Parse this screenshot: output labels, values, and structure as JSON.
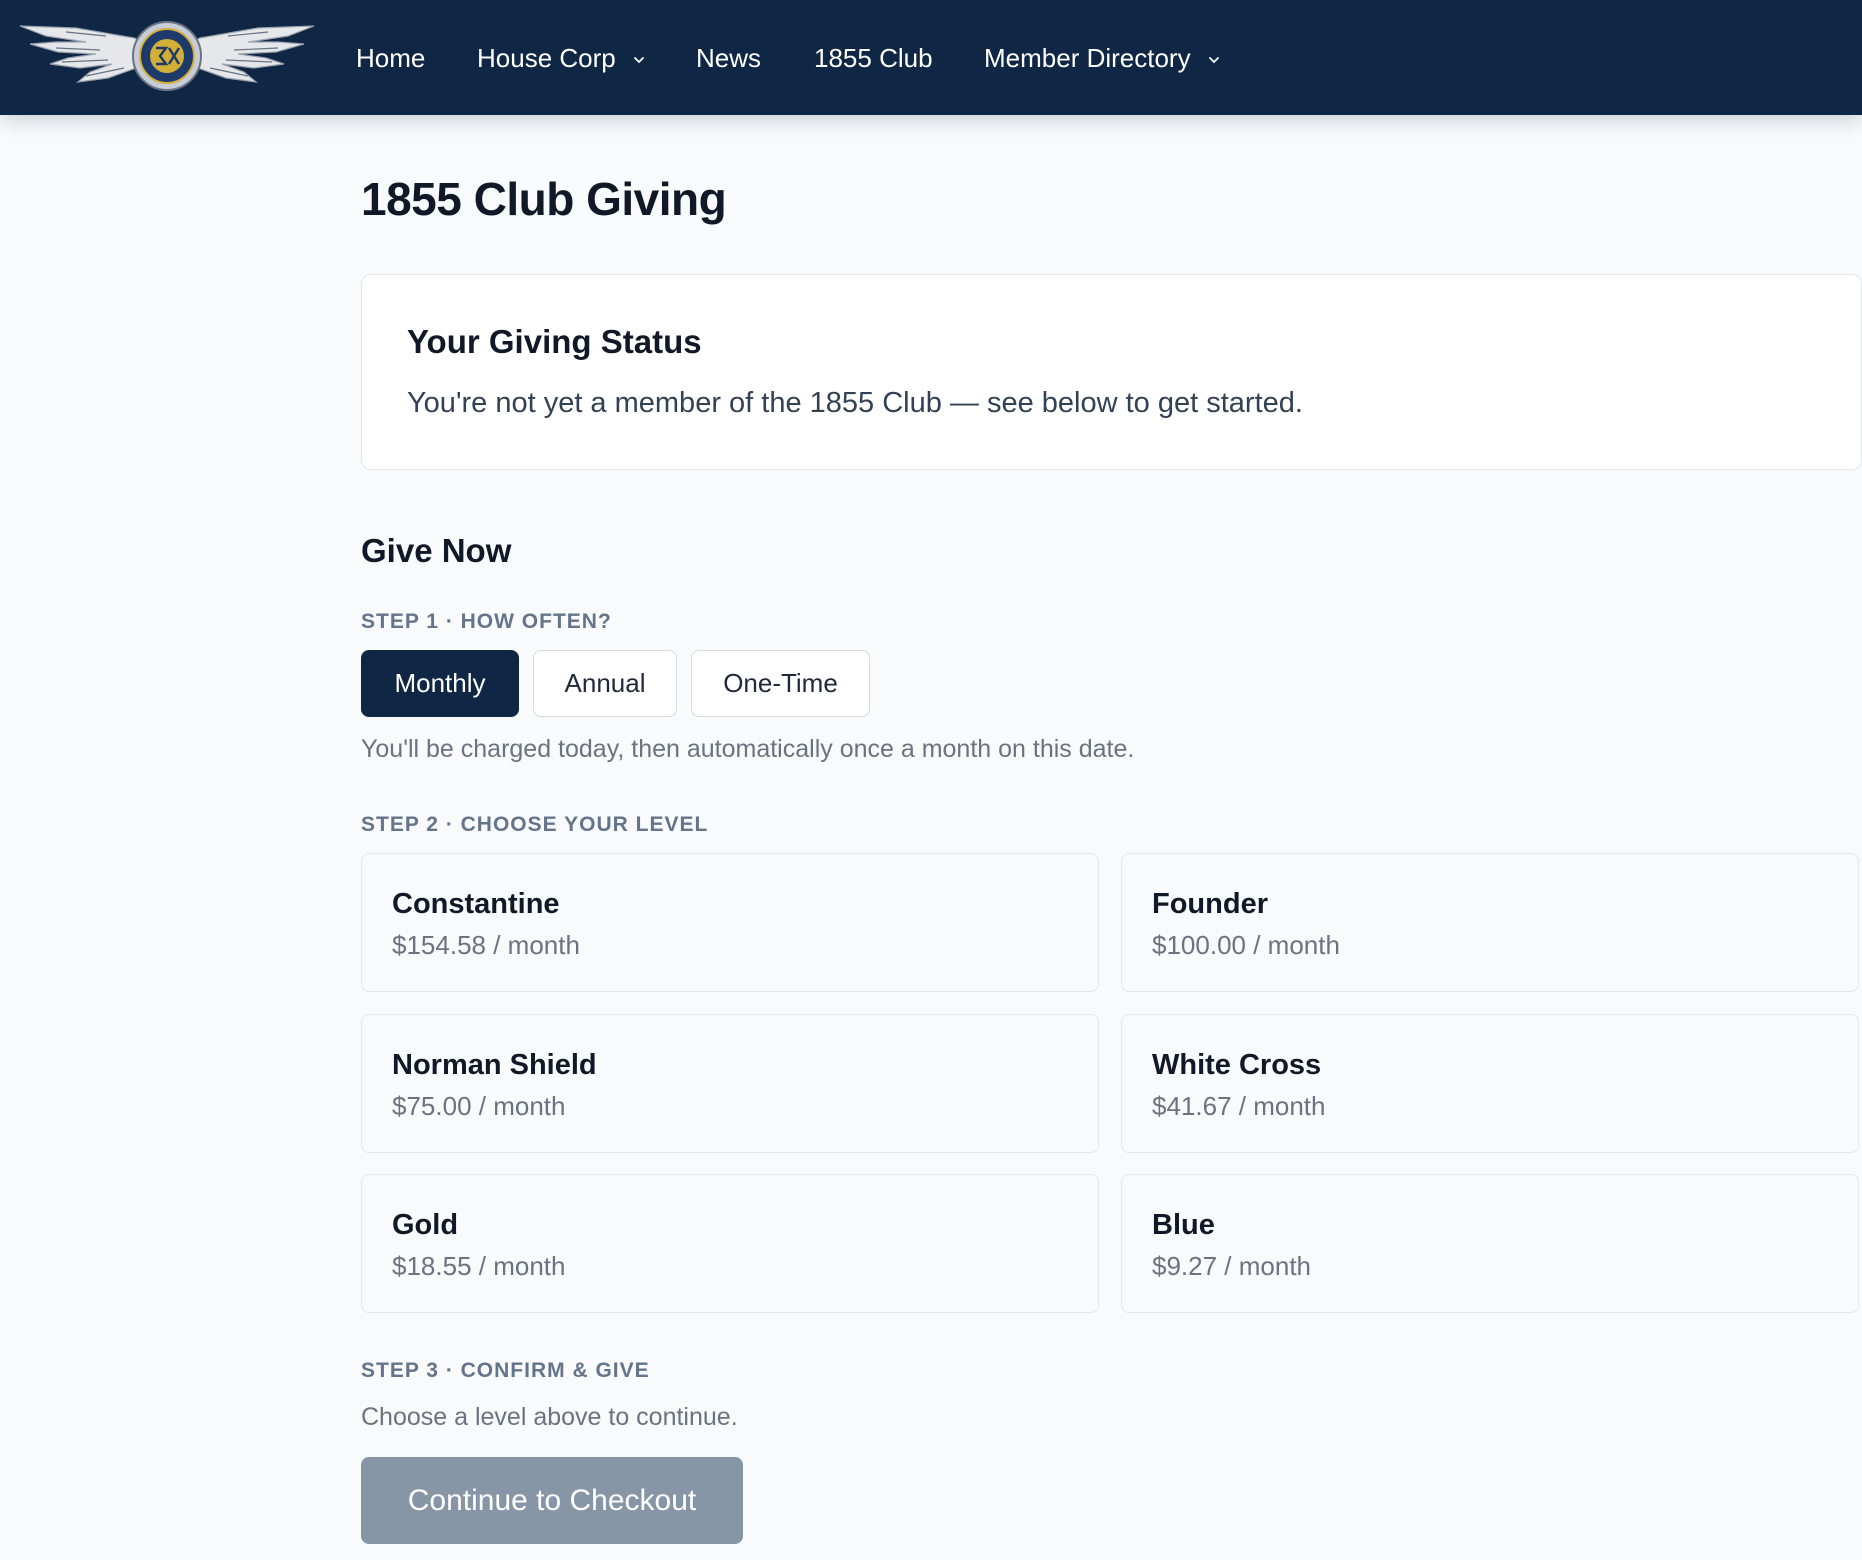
{
  "nav": {
    "logo_alt": "Sigma Chi badge",
    "items": [
      {
        "label": "Home",
        "has_dropdown": false
      },
      {
        "label": "House Corp",
        "has_dropdown": true
      },
      {
        "label": "News",
        "has_dropdown": false
      },
      {
        "label": "1855 Club",
        "has_dropdown": false
      },
      {
        "label": "Member Directory",
        "has_dropdown": true
      }
    ]
  },
  "page": {
    "title": "1855 Club Giving"
  },
  "status": {
    "title": "Your Giving Status",
    "text": "You're not yet a member of the 1855 Club — see below to get started."
  },
  "give": {
    "title": "Give Now",
    "step1": {
      "label": "STEP 1 · HOW OFTEN?",
      "options": [
        "Monthly",
        "Annual",
        "One-Time"
      ],
      "selected": "Monthly",
      "helper": "You'll be charged today, then automatically once a month on this date."
    },
    "step2": {
      "label": "STEP 2 · CHOOSE YOUR LEVEL",
      "levels": [
        {
          "name": "Constantine",
          "price": "$154.58 / month"
        },
        {
          "name": "Founder",
          "price": "$100.00 / month"
        },
        {
          "name": "Norman Shield",
          "price": "$75.00 / month"
        },
        {
          "name": "White Cross",
          "price": "$41.67 / month"
        },
        {
          "name": "Gold",
          "price": "$18.55 / month"
        },
        {
          "name": "Blue",
          "price": "$9.27 / month"
        }
      ]
    },
    "step3": {
      "label": "STEP 3 · CONFIRM & GIVE",
      "helper": "Choose a level above to continue.",
      "button": "Continue to Checkout"
    }
  },
  "colors": {
    "nav_bg": "#0f2744",
    "page_bg": "#f8fafc",
    "active_button": "#0f2744",
    "disabled_button": "#8796a6"
  }
}
